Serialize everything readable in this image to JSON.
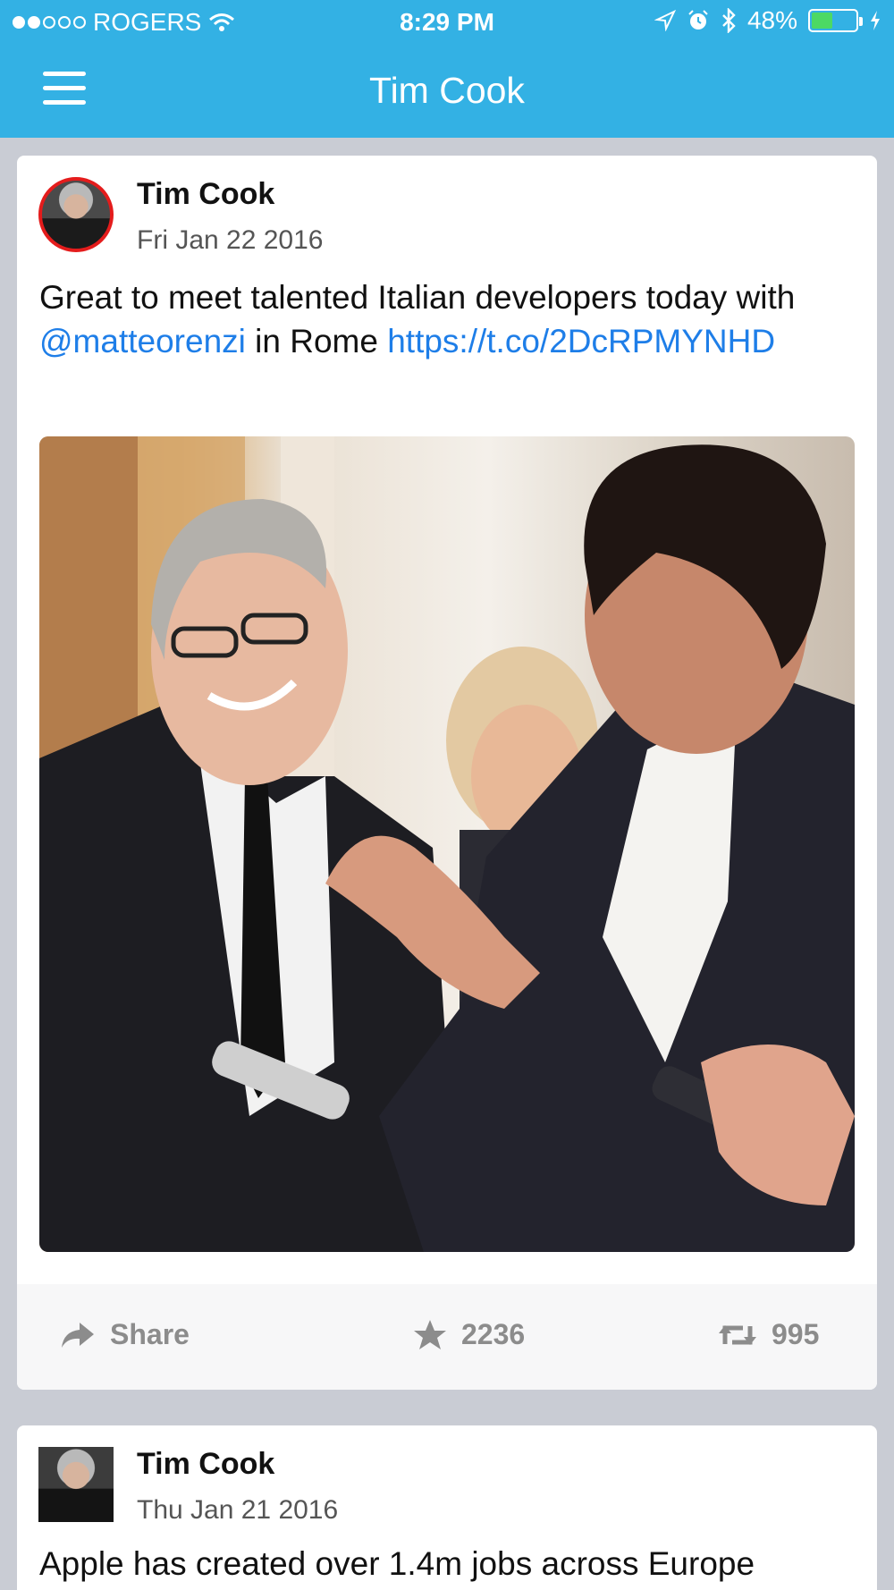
{
  "status_bar": {
    "carrier": "ROGERS",
    "time": "8:29 PM",
    "battery": "48%",
    "battery_level": 0.48,
    "signal_bars_on": 2,
    "signal_bars_total": 5
  },
  "nav": {
    "title": "Tim Cook"
  },
  "tweets": [
    {
      "author": "Tim Cook",
      "date": "Fri Jan 22 2016",
      "text_1": "Great to meet talented Italian developers today with ",
      "mention": "@matteorenzi",
      "text_2": " in Rome ",
      "link": "https://t.co/​2DcRPMYNHD",
      "actions": {
        "share_label": "Share",
        "favorites": "2236",
        "retweets": "995"
      }
    },
    {
      "author": "Tim Cook",
      "date": "Thu Jan 21 2016",
      "text": "Apple has created over 1.4m jobs across Europe"
    }
  ],
  "colors": {
    "accent": "#33b1e4",
    "link": "#1e7ee8",
    "avatar_ring": "#e41c1c",
    "battery": "#4cd964"
  },
  "icons": [
    "menu-icon",
    "wifi-icon",
    "location-icon",
    "alarm-icon",
    "bluetooth-icon",
    "battery-icon",
    "charging-icon",
    "share-icon",
    "star-icon",
    "retweet-icon"
  ]
}
